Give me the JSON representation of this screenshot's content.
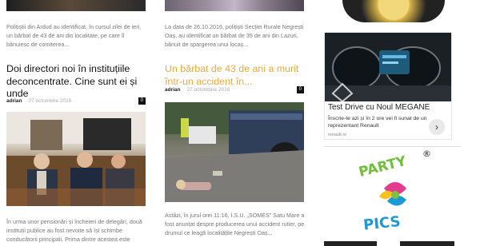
{
  "articles": {
    "a1": {
      "excerpt": "Polițiștii din Ardud au identificat, în cursul zilei de ieri, un bărbat de 43 de ani din localitate, pe care îl bănuiesc de comiterea..."
    },
    "a2": {
      "excerpt": "La data de 26.10.2016, polițiști Secției Rurale Negrești Oaș, au identificat un bărbat de 35 de ani din Lazuri, bănuit de spargerea unui locaș..."
    },
    "a3": {
      "title": "Doi directori noi în instituțiile deconcentrate. Cine sunt ei și unde",
      "author": "adrian",
      "date": "27 octombrie 2016",
      "comments": "0",
      "excerpt": "În urma unor pensionări și încheieri de delegări, două instituții publice au fost nevoite să își schimbe conducătorii principali. Prima dintre acestea este"
    },
    "a4": {
      "title": "Un bărbat de 43 de ani a murit într-un accident în...",
      "author": "adrian",
      "date": "27 octombrie 2016",
      "comments": "0",
      "excerpt": "Astăzi, în jurul orei 11:16, I.S.U. „SOMES” Satu Mare a fost anunțat despre producerea unui accident rutier, pe drumul ce leagă localitățile Negrești Oaș..."
    }
  },
  "sidebar": {
    "ad": {
      "title": "Test Drive cu Noul MEGANE",
      "text": "Înscrie-te azi și în 2 ore vei fi sunat de un reprezentant Renault",
      "domain": "renault.ro",
      "arrow": "›"
    },
    "logo": {
      "line1": "PARTY",
      "line2": "PICS",
      "mark": "®"
    }
  },
  "colors": {
    "accent_title": "#f0a93b",
    "badge": "#111111"
  },
  "icons": {
    "ad_arrow": "chevron-right-icon"
  }
}
